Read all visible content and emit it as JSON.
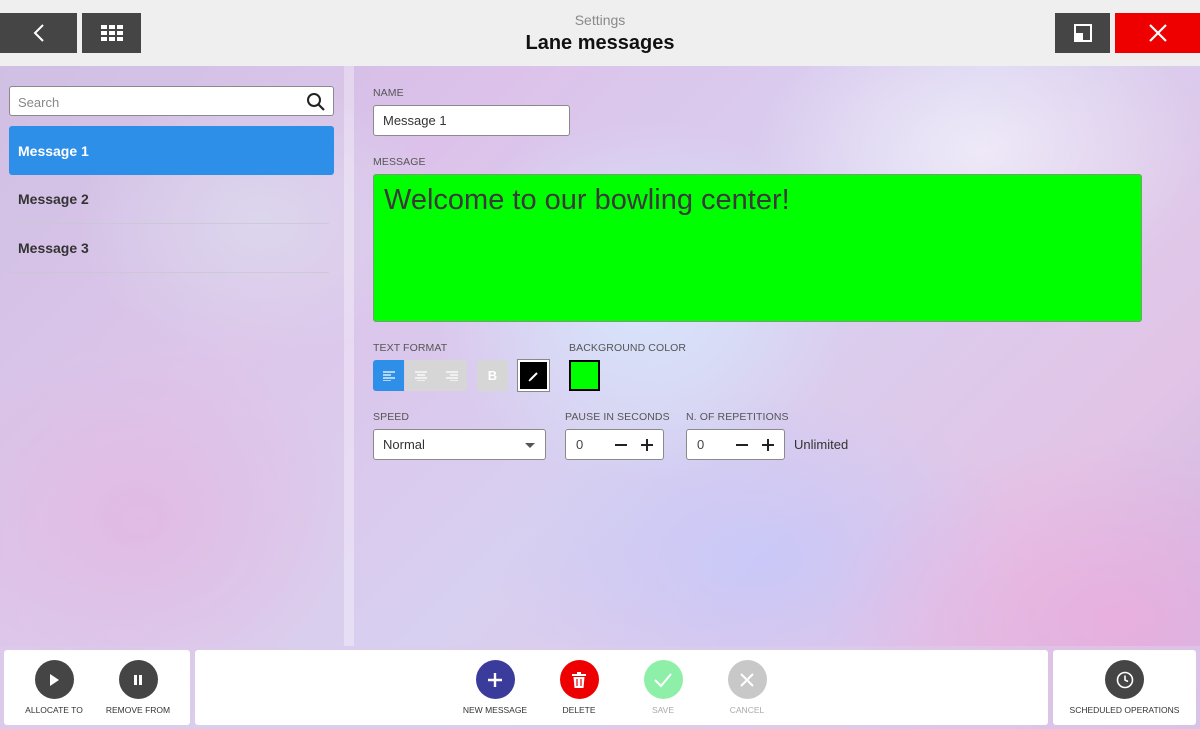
{
  "header": {
    "subtitle": "Settings",
    "title": "Lane messages"
  },
  "sidebar": {
    "search_placeholder": "Search",
    "items": [
      {
        "label": "Message 1",
        "active": true
      },
      {
        "label": "Message 2",
        "active": false
      },
      {
        "label": "Message 3",
        "active": false
      }
    ]
  },
  "form": {
    "name_label": "NAME",
    "name_value": "Message 1",
    "message_label": "MESSAGE",
    "message_value": "Welcome to our bowling center!",
    "message_bg_color": "#00ff00",
    "text_format_label": "TEXT FORMAT",
    "bold_label": "B",
    "text_color": "#000000",
    "background_color_label": "BACKGROUND COLOR",
    "background_color": "#00ff00",
    "speed_label": "SPEED",
    "speed_value": "Normal",
    "pause_label": "PAUSE IN SECONDS",
    "pause_value": "0",
    "repetitions_label": "N. OF REPETITIONS",
    "repetitions_value": "0",
    "repetitions_note": "Unlimited"
  },
  "bottom": {
    "allocate": "ALLOCATE TO",
    "remove": "REMOVE FROM",
    "new_message": "NEW MESSAGE",
    "delete": "DELETE",
    "save": "SAVE",
    "cancel": "CANCEL",
    "scheduled": "SCHEDULED OPERATIONS"
  },
  "colors": {
    "accent": "#2d8fe8",
    "close": "#ee0000",
    "new_message": "#3b3b9c",
    "delete": "#ee0000",
    "save_disabled": "#8ef0a8",
    "cancel_disabled": "#c8c8c8",
    "dark_button": "#454545"
  }
}
